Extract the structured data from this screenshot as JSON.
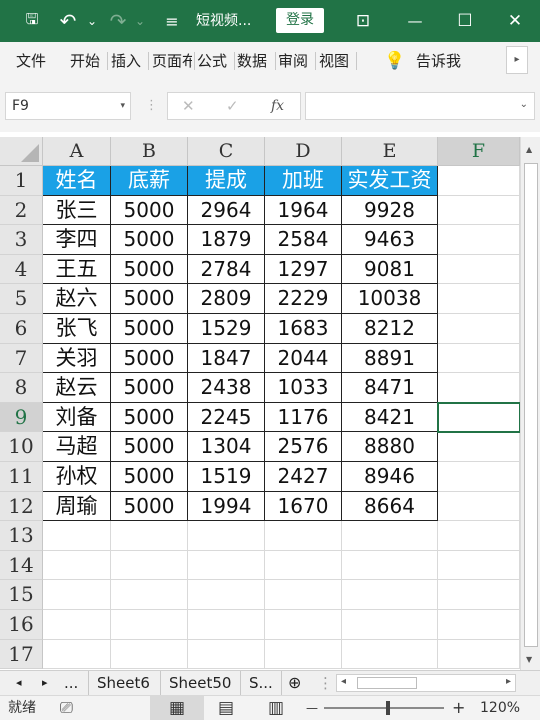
{
  "titlebar": {
    "doc_title": "短视频...",
    "login": "登录",
    "save_glyph": "🖫",
    "undo_glyph": "↶",
    "undo_dd": "⌄",
    "redo_glyph": "↷",
    "redo_dd": "⌄",
    "qat_glyph": "≡",
    "ribbon_glyph": "⊡",
    "minimize_glyph": "—",
    "restore_glyph": "☐",
    "close_glyph": "✕"
  },
  "ribbon": {
    "tabs": [
      "文件",
      "开始",
      "插入",
      "页面布",
      "公式",
      "数据",
      "审阅",
      "视图"
    ],
    "tell_me_icon": "💡",
    "tell_me": "告诉我",
    "scroll_glyph": "▸"
  },
  "formula_bar": {
    "name_box": "F9",
    "name_box_dd": "▾",
    "dots": "⋮",
    "cancel": "✕",
    "enter": "✓",
    "fx": "fx",
    "formula": "",
    "expand_dd": "⌄"
  },
  "grid": {
    "columns": [
      "A",
      "B",
      "C",
      "D",
      "E",
      "F"
    ],
    "active_column": "F",
    "row_numbers": [
      "1",
      "2",
      "3",
      "4",
      "5",
      "6",
      "7",
      "8",
      "9",
      "10",
      "11",
      "12",
      "13",
      "14",
      "15",
      "16",
      "17"
    ],
    "active_row": "9",
    "header_row": [
      "姓名",
      "底薪",
      "提成",
      "加班",
      "实发工资"
    ],
    "rows": [
      [
        "张三",
        "5000",
        "2964",
        "1964",
        "9928"
      ],
      [
        "李四",
        "5000",
        "1879",
        "2584",
        "9463"
      ],
      [
        "王五",
        "5000",
        "2784",
        "1297",
        "9081"
      ],
      [
        "赵六",
        "5000",
        "2809",
        "2229",
        "10038"
      ],
      [
        "张飞",
        "5000",
        "1529",
        "1683",
        "8212"
      ],
      [
        "关羽",
        "5000",
        "1847",
        "2044",
        "8891"
      ],
      [
        "赵云",
        "5000",
        "2438",
        "1033",
        "8471"
      ],
      [
        "刘备",
        "5000",
        "2245",
        "1176",
        "8421"
      ],
      [
        "马超",
        "5000",
        "1304",
        "2576",
        "8880"
      ],
      [
        "孙权",
        "5000",
        "1519",
        "2427",
        "8946"
      ],
      [
        "周瑜",
        "5000",
        "1994",
        "1670",
        "8664"
      ]
    ],
    "header_color": "#1aa1e6",
    "accent_color": "#217346"
  },
  "sheets": {
    "prev": "◂",
    "next": "▸",
    "more": "...",
    "tabs": [
      "Sheet6",
      "Sheet50",
      "S..."
    ],
    "add": "⊕",
    "menu": "⋮",
    "scroll_left": "◂",
    "scroll_right": "▸"
  },
  "status": {
    "ready": "就绪",
    "macro_icon": "⎚",
    "normal_view": "▦",
    "page_layout_view": "▤",
    "page_break_view": "▥",
    "zoom_out": "—",
    "zoom_in": "+",
    "zoom": "120%"
  }
}
